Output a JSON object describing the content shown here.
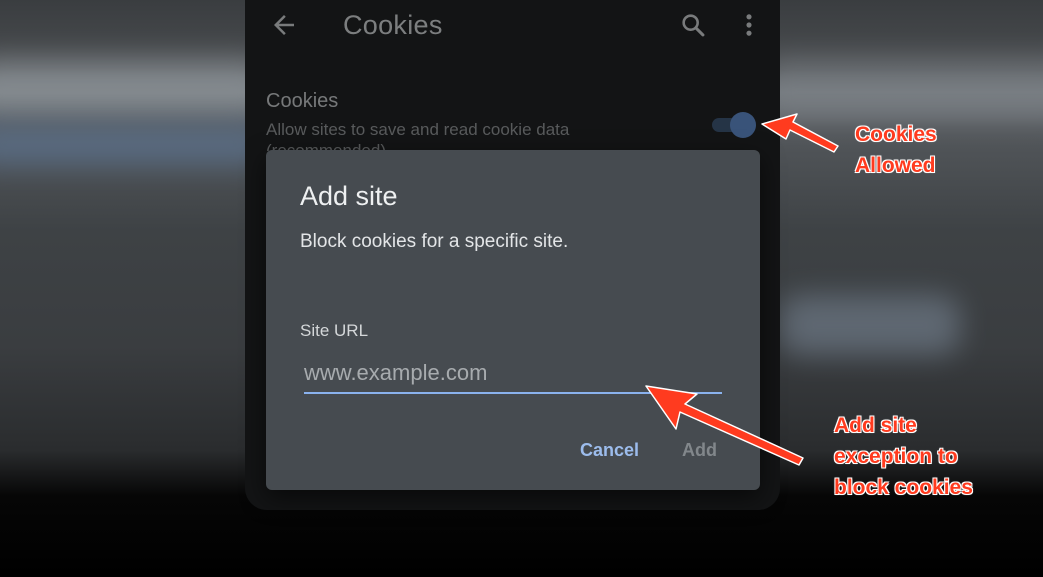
{
  "appbar": {
    "title": "Cookies",
    "back_icon": "arrow-back-icon",
    "search_icon": "search-icon",
    "more_icon": "more-vert-icon"
  },
  "setting": {
    "title": "Cookies",
    "description": "Allow sites to save and read cookie data (recommended)",
    "toggle_state": "on"
  },
  "dialog": {
    "title": "Add site",
    "message": "Block cookies for a specific site.",
    "field_label": "Site URL",
    "input_value": "",
    "input_placeholder": "www.example.com",
    "cancel_label": "Cancel",
    "add_label": "Add"
  },
  "annotations": {
    "toggle_note": "Cookies\nAllowed",
    "input_note": "Add site\nexception to\nblock cookies"
  },
  "colors": {
    "accent": "#8ab2ee",
    "annotation": "#ff3b1f",
    "dialog_bg": "#464b50"
  }
}
